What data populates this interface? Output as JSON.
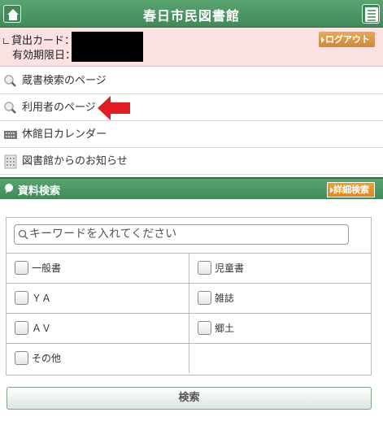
{
  "header": {
    "title": "春日市民図書館"
  },
  "user": {
    "card_label": "貸出カード：",
    "expiry_label": "有効期限日：",
    "logout_label": "ログアウト"
  },
  "nav": {
    "items": [
      {
        "label": "蔵書検索のページ",
        "icon": "magnifier-icon"
      },
      {
        "label": "利用者のページ",
        "icon": "magnifier-icon"
      },
      {
        "label": "休館日カレンダー",
        "icon": "calendar-icon"
      },
      {
        "label": "図書館からのお知らせ",
        "icon": "notice-icon"
      }
    ]
  },
  "search": {
    "heading": "資料検索",
    "detail_label": "詳細検索",
    "keyword_placeholder": "キーワードを入れてください",
    "categories": [
      "一般書",
      "児童書",
      "ＹＡ",
      "雑誌",
      "ＡＶ",
      "郷土",
      "その他"
    ],
    "submit_label": "検索"
  },
  "colors": {
    "header_green": "#4a9665",
    "card_bg": "#fbe1e1",
    "logout": "#cd8a36",
    "detail": "#e08818",
    "pointer_arrow": "#e31b23"
  }
}
